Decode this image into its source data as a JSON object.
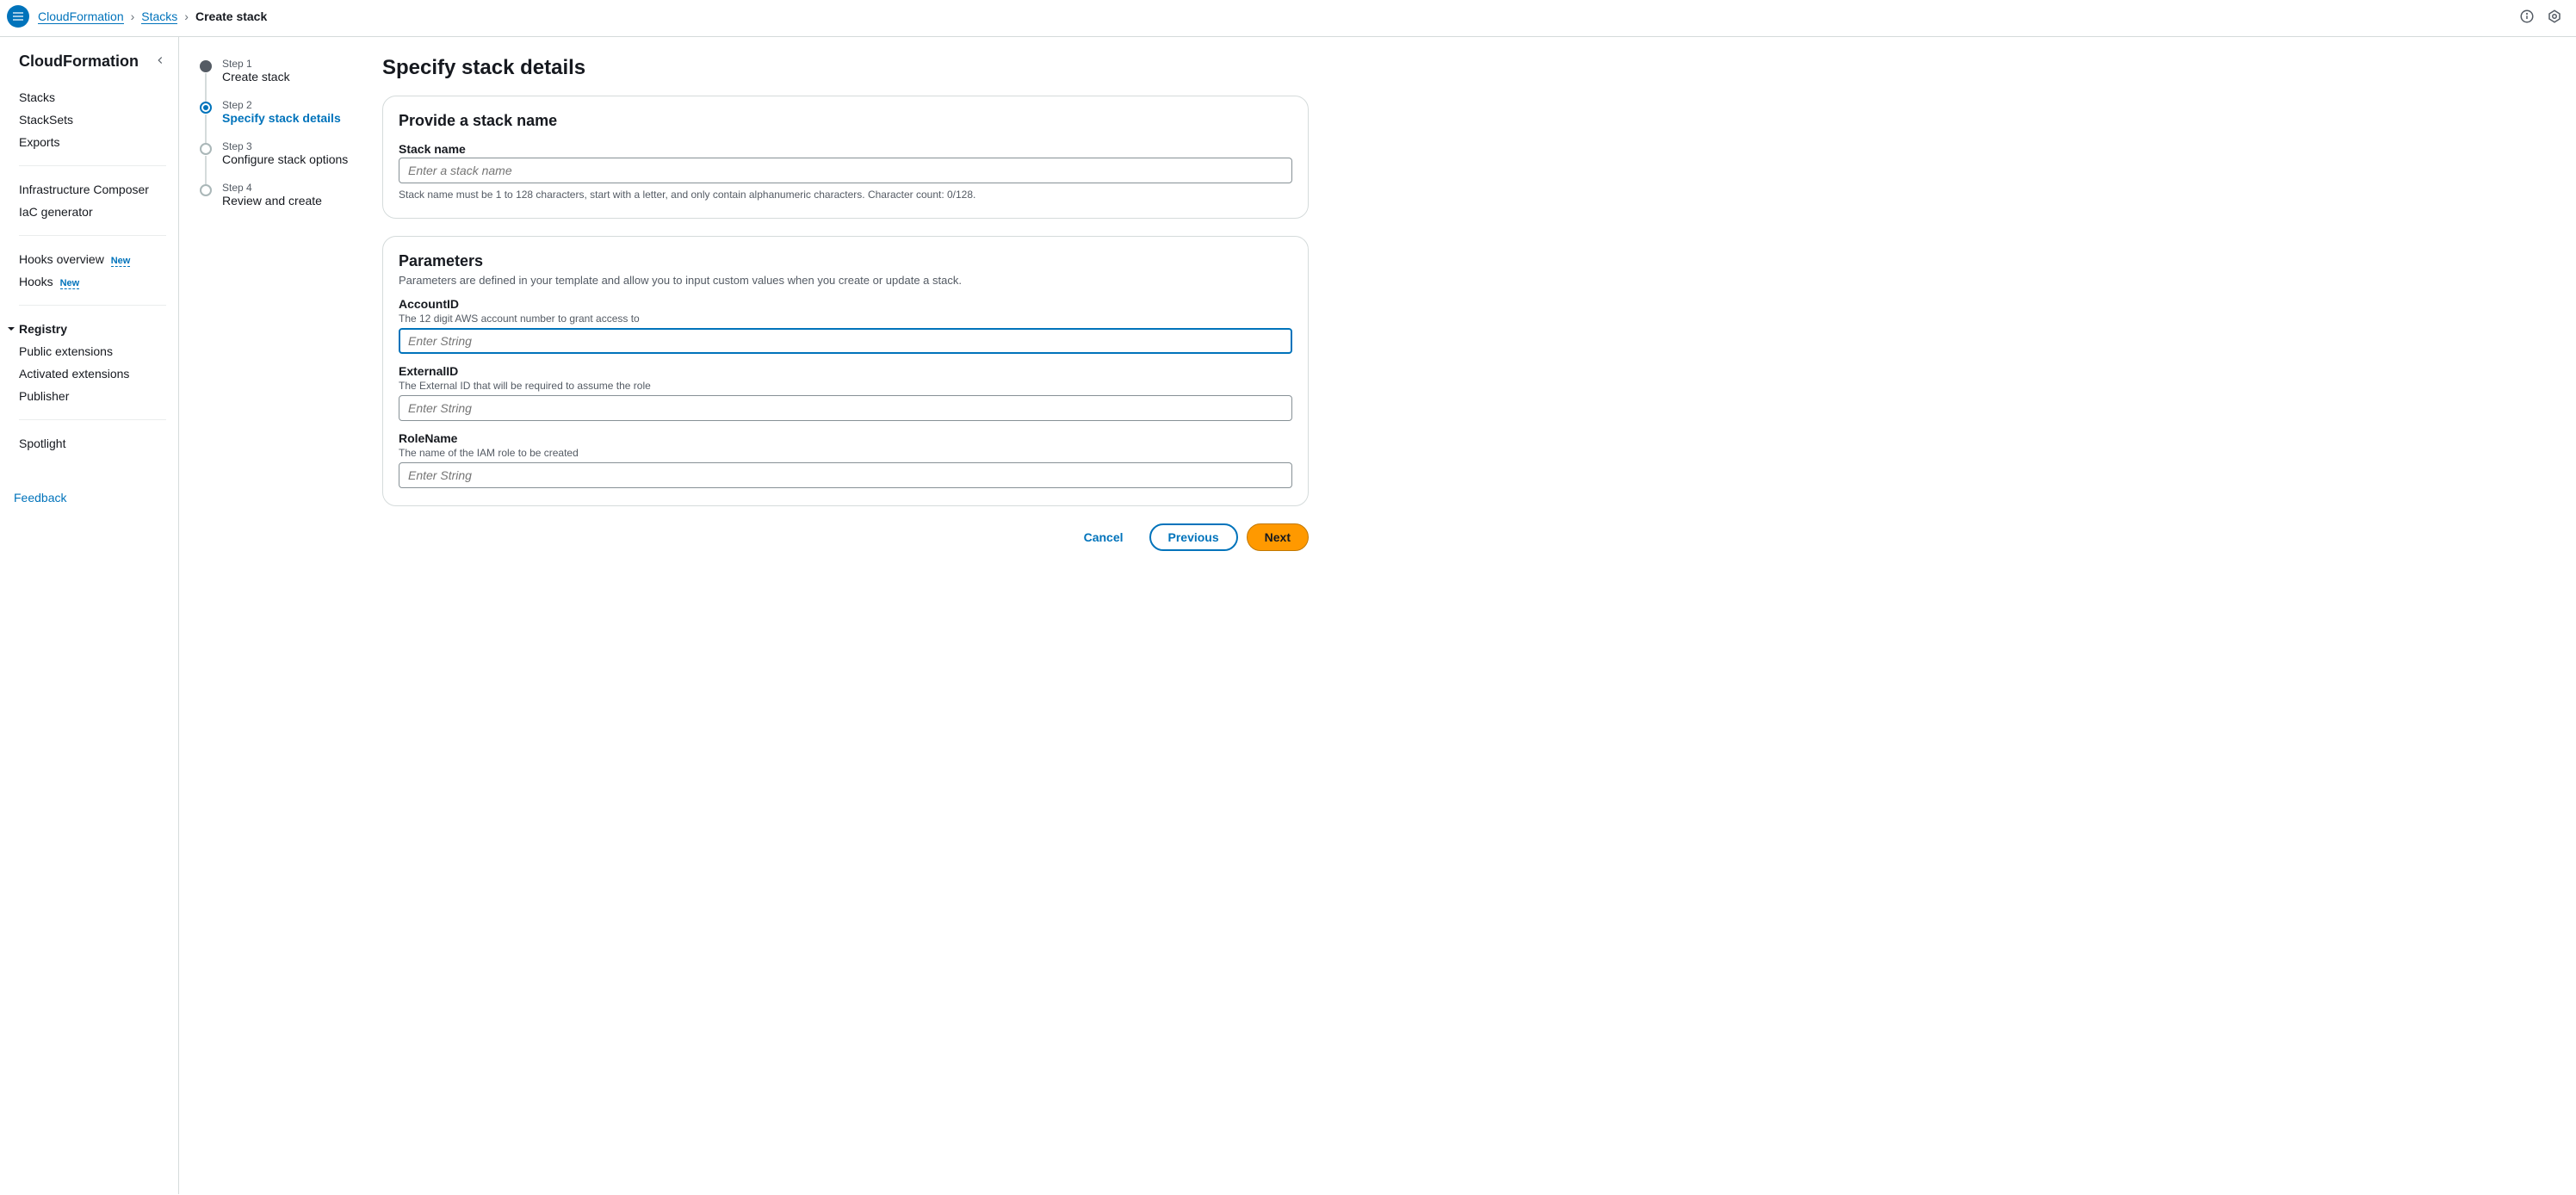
{
  "breadcrumb": {
    "home": "CloudFormation",
    "stacks": "Stacks",
    "current": "Create stack"
  },
  "sidebar": {
    "title": "CloudFormation",
    "group1": [
      "Stacks",
      "StackSets",
      "Exports"
    ],
    "group2": [
      "Infrastructure Composer",
      "IaC generator"
    ],
    "group3": [
      {
        "label": "Hooks overview",
        "badge": "New"
      },
      {
        "label": "Hooks",
        "badge": "New"
      }
    ],
    "registry_label": "Registry",
    "registry_items": [
      "Public extensions",
      "Activated extensions",
      "Publisher"
    ],
    "group5": [
      "Spotlight"
    ],
    "feedback": "Feedback"
  },
  "wizard": {
    "steps": [
      {
        "label": "Step 1",
        "title": "Create stack"
      },
      {
        "label": "Step 2",
        "title": "Specify stack details"
      },
      {
        "label": "Step 3",
        "title": "Configure stack options"
      },
      {
        "label": "Step 4",
        "title": "Review and create"
      }
    ]
  },
  "page": {
    "title": "Specify stack details",
    "section_name": {
      "heading": "Provide a stack name",
      "field_label": "Stack name",
      "placeholder": "Enter a stack name",
      "hint": "Stack name must be 1 to 128 characters, start with a letter, and only contain alphanumeric characters. Character count: 0/128."
    },
    "section_params": {
      "heading": "Parameters",
      "subtitle": "Parameters are defined in your template and allow you to input custom values when you create or update a stack.",
      "fields": [
        {
          "label": "AccountID",
          "desc": "The 12 digit AWS account number to grant access to",
          "placeholder": "Enter String"
        },
        {
          "label": "ExternalID",
          "desc": "The External ID that will be required to assume the role",
          "placeholder": "Enter String"
        },
        {
          "label": "RoleName",
          "desc": "The name of the IAM role to be created",
          "placeholder": "Enter String"
        }
      ]
    },
    "actions": {
      "cancel": "Cancel",
      "previous": "Previous",
      "next": "Next"
    }
  }
}
